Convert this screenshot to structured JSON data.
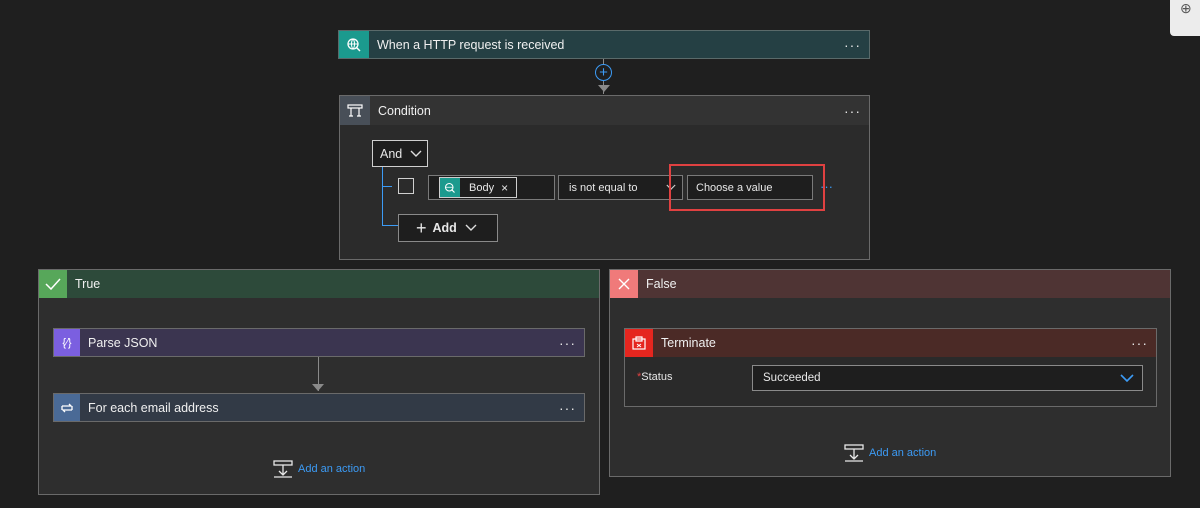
{
  "trigger": {
    "title": "When a HTTP request is received"
  },
  "condition": {
    "title": "Condition",
    "group_operator": "And",
    "token_label": "Body",
    "operator": "is not equal to",
    "value_placeholder": "Choose a value",
    "add_label": "Add"
  },
  "true_branch": {
    "title": "True",
    "actions": [
      {
        "title": "Parse JSON"
      },
      {
        "title": "For each email address"
      }
    ],
    "add_action_label": "Add an action"
  },
  "false_branch": {
    "title": "False",
    "terminate": {
      "title": "Terminate",
      "status_label": "Status",
      "status_value": "Succeeded"
    },
    "add_action_label": "Add an action"
  },
  "colors": {
    "trigger_header": "#254044",
    "trigger_icon": "#1b9a8e",
    "condition_icon": "#484f58",
    "true_header": "#2d4a3a",
    "true_icon": "#57a75a",
    "false_header": "#4f3434",
    "false_icon": "#f07a7a",
    "parse_json_header": "#3b3550",
    "parse_json_icon": "#7b5fe0",
    "foreach_header": "#323a46",
    "foreach_icon": "#4a6a96",
    "terminate_header": "#4b2a26",
    "terminate_icon": "#e5261f",
    "highlight": "#e04141",
    "link": "#3c9bf5"
  }
}
